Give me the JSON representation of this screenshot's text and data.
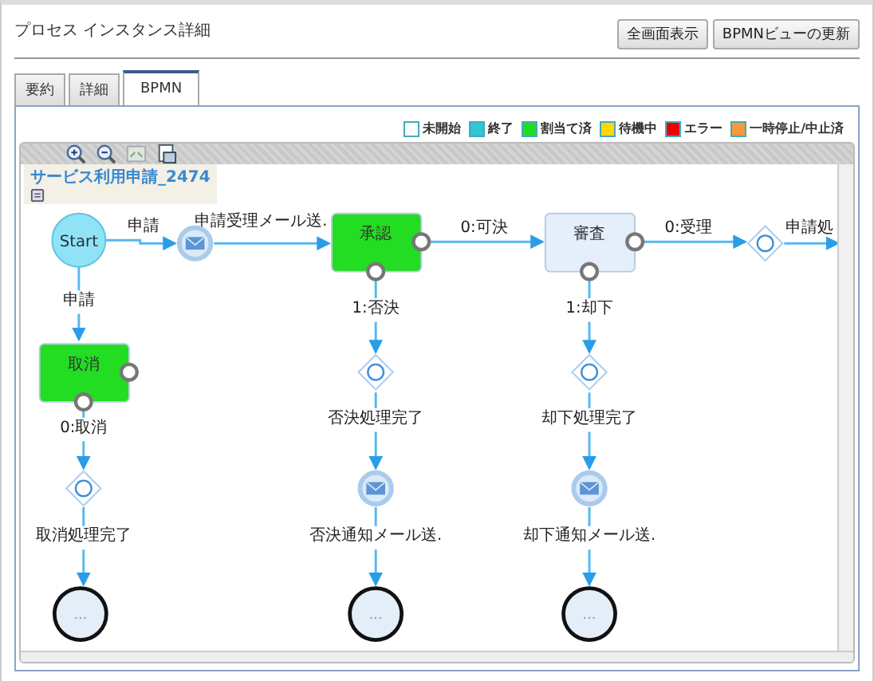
{
  "window": {
    "title": "プロセス インスタンス詳細"
  },
  "buttons": [
    "全画面表示",
    "BPMNビューの更新"
  ],
  "tabs": [
    {
      "label": "要約",
      "selected": false
    },
    {
      "label": "詳細",
      "selected": false
    },
    {
      "label": "BPMN",
      "selected": true
    }
  ],
  "legend": [
    {
      "label": "未開始",
      "color": "#ffffff"
    },
    {
      "label": "終了",
      "color": "#33c4d8"
    },
    {
      "label": "割当て済",
      "color": "#22dd22"
    },
    {
      "label": "待機中",
      "color": "#ffd700"
    },
    {
      "label": "エラー",
      "color": "#ee0000"
    },
    {
      "label": "一時停止/中止済",
      "color": "#f59a3a"
    }
  ],
  "process": {
    "name": "サービス利用申請_2474"
  },
  "diagram": {
    "nodes": [
      {
        "kind": "start",
        "label": "Start"
      },
      {
        "kind": "message"
      },
      {
        "kind": "task",
        "label": "承認",
        "color": "#22dd22"
      },
      {
        "kind": "task",
        "label": "審査",
        "color": "#e4effb"
      },
      {
        "kind": "gateway"
      },
      {
        "kind": "task",
        "label": "取消",
        "color": "#22dd22"
      },
      {
        "kind": "gateway"
      },
      {
        "kind": "end",
        "label": "..."
      },
      {
        "kind": "gateway"
      },
      {
        "kind": "message"
      },
      {
        "kind": "end",
        "label": "..."
      },
      {
        "kind": "gateway"
      },
      {
        "kind": "message"
      },
      {
        "kind": "end",
        "label": "..."
      }
    ],
    "edges": [
      {
        "label": "申請"
      },
      {
        "label": "申請受理メール送."
      },
      {
        "label": "0:可決"
      },
      {
        "label": "0:受理"
      },
      {
        "label": "申請処"
      },
      {
        "label": "申請"
      },
      {
        "label": "0:取消"
      },
      {
        "label": "取消処理完了"
      },
      {
        "label": "1:否決"
      },
      {
        "label": "否決処理完了"
      },
      {
        "label": "否決通知メール送."
      },
      {
        "label": "1:却下"
      },
      {
        "label": "却下処理完了"
      },
      {
        "label": "却下通知メール送."
      }
    ]
  }
}
